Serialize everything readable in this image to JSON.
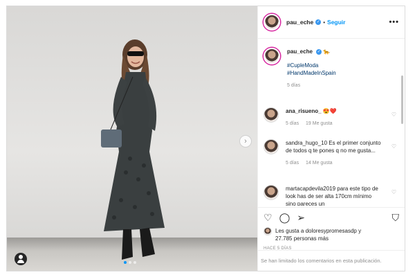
{
  "post": {
    "username": "pau_eche",
    "follow_label": "Seguir",
    "more_label": "•••",
    "caption_emoji": "🐆",
    "hashtags": [
      "#CupleModa",
      "#HandMadeInSpain"
    ],
    "caption_time": "5 días",
    "carousel": {
      "slides": 3,
      "active_index": 0
    }
  },
  "comments": [
    {
      "user": "ana_risueno_",
      "text": "😍❤️",
      "time": "5 días",
      "likes": "19 Me gusta"
    },
    {
      "user": "sandra_hugo_10",
      "text": "Es el primer conjunto de todos q te pones q no me gusta...",
      "time": "5 días",
      "likes": "14 Me gusta"
    },
    {
      "user": "martacapdevila2019",
      "text": "para este tipo de look has de ser alta 170cm mínimo sino pareces un"
    }
  ],
  "actions": {
    "like_icon": "heart-icon",
    "comment_icon": "comment-icon",
    "share_icon": "share-icon",
    "save_icon": "bookmark-icon",
    "likes_prefix": "Les gusta a",
    "likes_user": "doloresypromesasdp",
    "likes_suffix": "y",
    "likes_count_text": "27.785 personas más",
    "timestamp": "HACE 5 DÍAS"
  },
  "comments_limited": "Se han limitado los comentarios en esta publicación.",
  "colors": {
    "accent": "#0095f6",
    "text": "#262626",
    "muted": "#8e8e8e",
    "border": "#dbdbdb"
  }
}
